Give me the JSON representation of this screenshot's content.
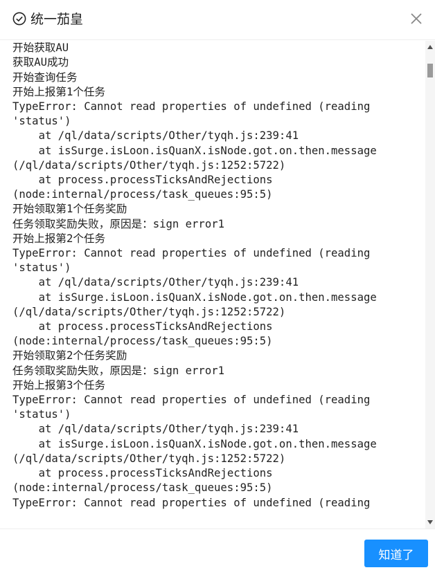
{
  "dialog": {
    "title": "统一茄皇",
    "ok_label": "知道了",
    "title_icon": "check-circle-icon",
    "close_icon": "close-icon",
    "accent_color": "#1890ff"
  },
  "log": {
    "lines": [
      "开始获取AU（部分遮挡）",
      "开始获取AU",
      "获取AU成功",
      "开始查询任务",
      "开始上报第1个任务",
      "TypeError: Cannot read properties of undefined (reading",
      "'status')",
      "    at /ql/data/scripts/Other/tyqh.js:239:41",
      "    at isSurge.isLoon.isQuanX.isNode.got.on.then.message",
      "(/ql/data/scripts/Other/tyqh.js:1252:5722)",
      "    at process.processTicksAndRejections",
      "(node:internal/process/task_queues:95:5)",
      "开始领取第1个任务奖励",
      "任务领取奖励失败，原因是：sign error1",
      "开始上报第2个任务",
      "TypeError: Cannot read properties of undefined (reading",
      "'status')",
      "    at /ql/data/scripts/Other/tyqh.js:239:41",
      "    at isSurge.isLoon.isQuanX.isNode.got.on.then.message",
      "(/ql/data/scripts/Other/tyqh.js:1252:5722)",
      "    at process.processTicksAndRejections",
      "(node:internal/process/task_queues:95:5)",
      "开始领取第2个任务奖励",
      "任务领取奖励失败，原因是：sign error1",
      "开始上报第3个任务",
      "TypeError: Cannot read properties of undefined (reading",
      "'status')",
      "    at /ql/data/scripts/Other/tyqh.js:239:41",
      "    at isSurge.isLoon.isQuanX.isNode.got.on.then.message",
      "(/ql/data/scripts/Other/tyqh.js:1252:5722)",
      "    at process.processTicksAndRejections",
      "(node:internal/process/task_queues:95:5)",
      "TypeError: Cannot read properties of undefined (reading"
    ]
  }
}
